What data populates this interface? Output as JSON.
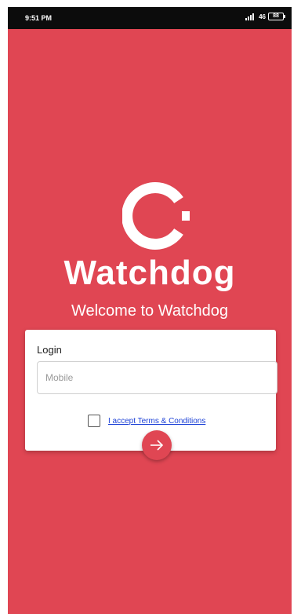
{
  "status_bar": {
    "time": "9:51 PM",
    "network": "46",
    "battery": "88"
  },
  "brand": {
    "name": "Watchdog",
    "accent_color": "#e04653"
  },
  "welcome": "Welcome to Watchdog",
  "login_card": {
    "title": "Login",
    "mobile_placeholder": "Mobile",
    "mobile_value": "",
    "terms_label": "I accept Terms & Conditions",
    "terms_checked": false
  },
  "icons": {
    "next_button": "arrow-right-icon",
    "logo": "watchdog-logo-icon"
  }
}
